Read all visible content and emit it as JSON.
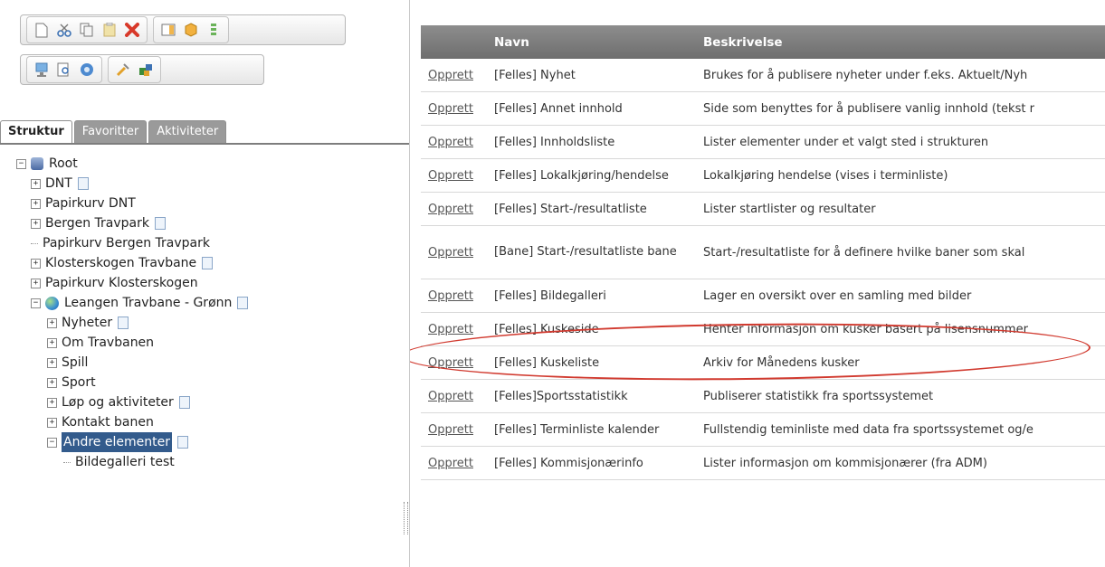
{
  "toolbar1": {
    "icons": [
      "new-page-icon",
      "cut-icon",
      "copy-icon",
      "paste-icon",
      "delete-icon",
      "panel-icon",
      "module-icon",
      "properties-icon"
    ]
  },
  "toolbar2": {
    "icons": [
      "preview-icon",
      "search-doc-icon",
      "help-icon",
      "tools-icon",
      "publish-icon"
    ]
  },
  "tabs": [
    "Struktur",
    "Favoritter",
    "Aktiviteter"
  ],
  "tree": {
    "root": "Root",
    "items": [
      {
        "label": "DNT"
      },
      {
        "label": "Papirkurv DNT"
      },
      {
        "label": "Bergen Travpark"
      },
      {
        "label": "Papirkurv Bergen Travpark"
      },
      {
        "label": "Klosterskogen Travbane"
      },
      {
        "label": "Papirkurv Klosterskogen"
      },
      {
        "label": "Leangen Travbane - Grønn"
      },
      {
        "label": "Nyheter"
      },
      {
        "label": "Om Travbanen"
      },
      {
        "label": "Spill"
      },
      {
        "label": "Sport"
      },
      {
        "label": "Løp og aktiviteter"
      },
      {
        "label": "Kontakt banen"
      },
      {
        "label": "Andre elementer"
      },
      {
        "label": "Bildegalleri test"
      }
    ]
  },
  "table": {
    "headers": [
      "",
      "Navn",
      "Beskrivelse"
    ],
    "action_label": "Opprett",
    "rows": [
      {
        "name": "[Felles] Nyhet",
        "desc": "Brukes for å publisere nyheter under f.eks. Aktuelt/Nyh"
      },
      {
        "name": "[Felles] Annet innhold",
        "desc": "Side som benyttes for å publisere vanlig innhold (tekst r"
      },
      {
        "name": "[Felles] Innholdsliste",
        "desc": "Lister elementer under et valgt sted i strukturen"
      },
      {
        "name": "[Felles] Lokalkjøring/hendelse",
        "desc": "Lokalkjøring hendelse (vises i terminliste)"
      },
      {
        "name": "[Felles] Start-/resultatliste",
        "desc": "Lister startlister og resultater"
      },
      {
        "name": "[Bane] Start-/resultatliste bane",
        "desc": "Start-/resultatliste for å definere hvilke baner som skal"
      },
      {
        "name": "[Felles] Bildegalleri",
        "desc": "Lager en oversikt over en samling med bilder"
      },
      {
        "name": "[Felles] Kuskeside",
        "desc": "Henter informasjon om kusker basert på lisensnummer"
      },
      {
        "name": "[Felles] Kuskeliste",
        "desc": "Arkiv for Månedens kusker"
      },
      {
        "name": "[Felles]Sportsstatistikk",
        "desc": "Publiserer statistikk fra sportssystemet"
      },
      {
        "name": "[Felles] Terminliste kalender",
        "desc": "Fullstendig teminliste med data fra sportssystemet og/e"
      },
      {
        "name": "[Felles] Kommisjonærinfo",
        "desc": "Lister informasjon om kommisjonærer (fra ADM)"
      }
    ]
  },
  "colors": {
    "header_bg": "#7a7a7a",
    "highlight": "#d13a2f",
    "selected_node": "#335b8c"
  }
}
